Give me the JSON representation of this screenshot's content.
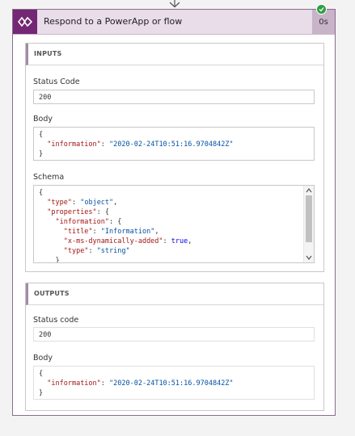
{
  "card": {
    "title": "Respond to a PowerApp or flow",
    "duration": "0s",
    "status_color": "#2f9e44",
    "accent_color": "#742774"
  },
  "inputs": {
    "title": "INPUTS",
    "status_code_label": "Status Code",
    "status_code_value": "200",
    "body_label": "Body",
    "body": {
      "key": "\"information\"",
      "value": "\"2020-02-24T10:51:16.9704842Z\""
    },
    "schema_label": "Schema",
    "schema": {
      "type_key": "\"type\"",
      "type_value": "\"object\"",
      "properties_key": "\"properties\"",
      "information_key": "\"information\"",
      "title_key": "\"title\"",
      "title_value": "\"Information\"",
      "dyn_key": "\"x-ms-dynamically-added\"",
      "dyn_value": "true",
      "inner_type_key": "\"type\"",
      "inner_type_value": "\"string\""
    }
  },
  "outputs": {
    "title": "OUTPUTS",
    "status_code_label": "Status code",
    "status_code_value": "200",
    "body_label": "Body",
    "body": {
      "key": "\"information\"",
      "value": "\"2020-02-24T10:51:16.9704842Z\""
    }
  },
  "icons": {
    "app": "powerapps-icon",
    "status": "success-check-icon",
    "connector": "arrow-down-icon"
  }
}
